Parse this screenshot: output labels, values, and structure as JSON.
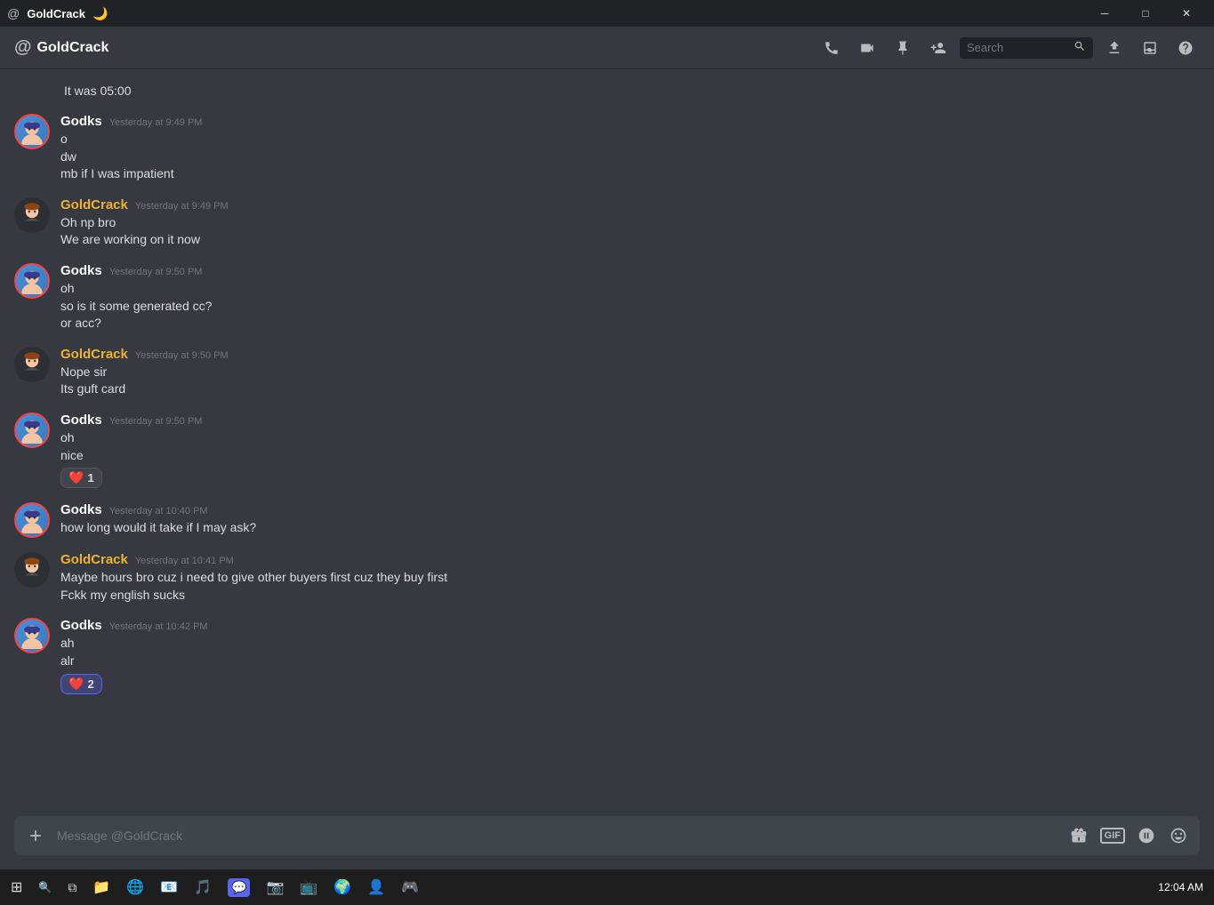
{
  "titlebar": {
    "title": "GoldCrack",
    "emoji": "🌙",
    "controls": {
      "minimize": "─",
      "maximize": "□",
      "close": "✕"
    }
  },
  "topbar": {
    "channel_name": "GoldCrack",
    "search_placeholder": "Search",
    "icons": {
      "call": "📞",
      "video": "📹",
      "pin": "📌",
      "add_friend": "👤+",
      "download": "⬇",
      "inbox": "🖥",
      "help": "❓"
    }
  },
  "messages": [
    {
      "id": "msg1",
      "type": "context",
      "text": "It was 05:00"
    },
    {
      "id": "msg2",
      "author": "Godks",
      "author_class": "godks",
      "timestamp": "Yesterday at 9:49 PM",
      "lines": [
        "o",
        "dw",
        "mb if I was impatient"
      ],
      "reactions": []
    },
    {
      "id": "msg3",
      "author": "GoldCrack",
      "author_class": "goldcrack",
      "timestamp": "Yesterday at 9:49 PM",
      "lines": [
        "Oh np bro",
        "We are working on it now"
      ],
      "reactions": []
    },
    {
      "id": "msg4",
      "author": "Godks",
      "author_class": "godks",
      "timestamp": "Yesterday at 9:50 PM",
      "lines": [
        "oh",
        "so is it some generated cc?",
        "or acc?"
      ],
      "reactions": []
    },
    {
      "id": "msg5",
      "author": "GoldCrack",
      "author_class": "goldcrack",
      "timestamp": "Yesterday at 9:50 PM",
      "lines": [
        "Nope sir",
        "Its guft card"
      ],
      "reactions": []
    },
    {
      "id": "msg6",
      "author": "Godks",
      "author_class": "godks",
      "timestamp": "Yesterday at 9:50 PM",
      "lines": [
        "oh",
        "nice"
      ],
      "reactions": [
        {
          "emoji": "❤️",
          "count": "1",
          "active": false
        }
      ]
    },
    {
      "id": "msg7",
      "author": "Godks",
      "author_class": "godks",
      "timestamp": "Yesterday at 10:40 PM",
      "lines": [
        "how long would it take if I may ask?"
      ],
      "reactions": []
    },
    {
      "id": "msg8",
      "author": "GoldCrack",
      "author_class": "goldcrack",
      "timestamp": "Yesterday at 10:41 PM",
      "lines": [
        "Maybe hours bro cuz i need to give other buyers first cuz they buy first",
        "Fckk my english sucks"
      ],
      "reactions": []
    },
    {
      "id": "msg9",
      "author": "Godks",
      "author_class": "godks",
      "timestamp": "Yesterday at 10:42 PM",
      "lines": [
        "ah",
        "alr"
      ],
      "reactions": [
        {
          "emoji": "❤️",
          "count": "2",
          "active": true
        }
      ]
    }
  ],
  "input": {
    "placeholder": "Message @GoldCrack"
  },
  "taskbar": {
    "clock": "12:04 AM",
    "items": [
      "🪟",
      "📁",
      "🌐",
      "📧",
      "🎵",
      "📷",
      "📺",
      "🌍",
      "👤",
      "🎮"
    ]
  }
}
